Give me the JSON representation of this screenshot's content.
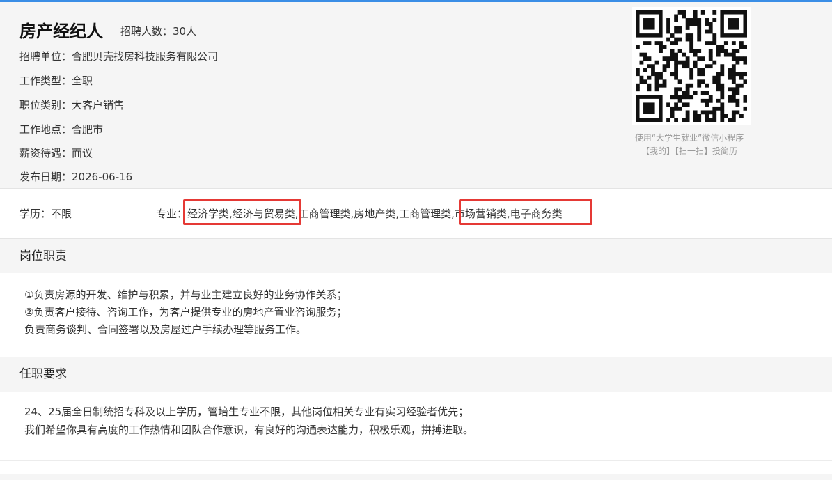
{
  "job": {
    "title": "房产经纪人",
    "hire_count": "招聘人数：30人",
    "info": [
      {
        "label": "招聘单位：",
        "value": "合肥贝壳找房科技服务有限公司"
      },
      {
        "label": "工作类型：",
        "value": "全职"
      },
      {
        "label": "职位类别：",
        "value": "大客户销售"
      },
      {
        "label": "工作地点：",
        "value": "合肥市"
      },
      {
        "label": "薪资待遇：",
        "value": "面议"
      },
      {
        "label": "发布日期：",
        "value": "2026-06-16"
      }
    ]
  },
  "qr": {
    "note_line1": "使用“大学生就业”微信小程序",
    "note_line2": "【我的】【扫一扫】投简历"
  },
  "requirements": {
    "education": "学历：不限",
    "major_label": "专业：",
    "major_value": "经济学类,经济与贸易类,工商管理类,房地产类,工商管理类,市场营销类,电子商务类"
  },
  "duties": {
    "heading": "岗位职责",
    "lines": [
      "①负责房源的开发、维护与积累，并与业主建立良好的业务协作关系；",
      "②负责客户接待、咨询工作，为客户提供专业的房地产置业咨询服务；",
      "负责商务谈判、合同签署以及房屋过户手续办理等服务工作。"
    ]
  },
  "qualifications": {
    "heading": "任职要求",
    "lines": [
      "24、25届全日制统招专科及以上学历，管培生专业不限，其他岗位相关专业有实习经验者优先；",
      "我们希望你具有高度的工作热情和团队合作意识，有良好的沟通表达能力，积极乐观，拼搏进取。"
    ]
  },
  "colors": {
    "accent": "#3a8ee6",
    "highlight": "#e53935",
    "panel": "#f5f5f5"
  }
}
